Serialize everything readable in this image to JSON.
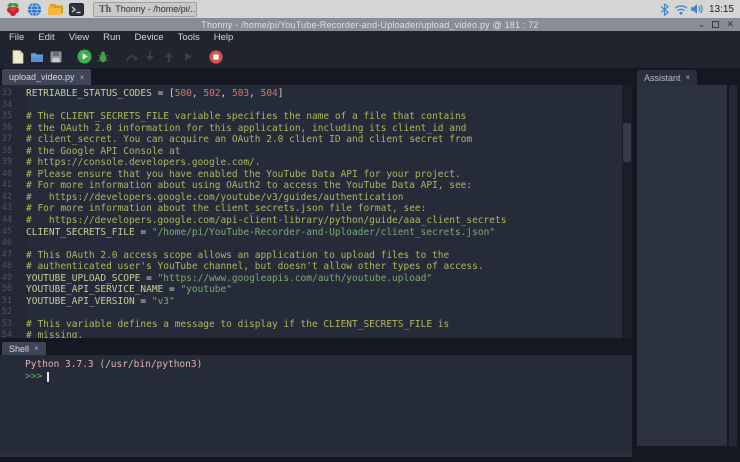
{
  "taskbar": {
    "launcher_icons": [
      "raspberry-menu",
      "web-browser",
      "file-manager",
      "terminal"
    ],
    "window_button": "Thonny - /home/pi/...",
    "status_icons": [
      "bluetooth",
      "wifi",
      "volume"
    ],
    "clock": "13:15"
  },
  "titlebar": {
    "title": "Thonny  -  /home/pi/YouTube-Recorder-and-Uploader/upload_video.py  @  181 : 72",
    "controls": {
      "minimize": "⌄",
      "maximize": "",
      "close": "✕"
    }
  },
  "menubar": {
    "items": [
      "File",
      "Edit",
      "View",
      "Run",
      "Device",
      "Tools",
      "Help"
    ]
  },
  "toolbar": {
    "buttons": [
      "new-file",
      "open-file",
      "save-file",
      "run-script",
      "debug-script",
      "step-over",
      "step-into",
      "step-out",
      "resume",
      "stop"
    ]
  },
  "editor": {
    "tab": {
      "label": "upload_video.py",
      "close": "×"
    },
    "first_line_number": 33,
    "lines": [
      [
        [
          "v",
          "RETRIABLE_STATUS_CODES"
        ],
        [
          "o",
          " = ["
        ],
        [
          "n",
          "500"
        ],
        [
          "o",
          ", "
        ],
        [
          "n",
          "502"
        ],
        [
          "o",
          ", "
        ],
        [
          "n",
          "503"
        ],
        [
          "o",
          ", "
        ],
        [
          "n",
          "504"
        ],
        [
          "o",
          "]"
        ]
      ],
      [],
      [
        [
          "c",
          "# The CLIENT_SECRETS_FILE variable specifies the name of a file that contains"
        ]
      ],
      [
        [
          "c",
          "# the OAuth 2.0 information for this application, including its client_id and"
        ]
      ],
      [
        [
          "c",
          "# client_secret. You can acquire an OAuth 2.0 client ID and client secret from"
        ]
      ],
      [
        [
          "c",
          "# the Google API Console at"
        ]
      ],
      [
        [
          "c",
          "# https://console.developers.google.com/."
        ]
      ],
      [
        [
          "c",
          "# Please ensure that you have enabled the YouTube Data API for your project."
        ]
      ],
      [
        [
          "c",
          "# For more information about using OAuth2 to access the YouTube Data API, see:"
        ]
      ],
      [
        [
          "c",
          "#   https://developers.google.com/youtube/v3/guides/authentication"
        ]
      ],
      [
        [
          "c",
          "# For more information about the client_secrets.json file format, see:"
        ]
      ],
      [
        [
          "c",
          "#   https://developers.google.com/api-client-library/python/guide/aaa_client_secrets"
        ]
      ],
      [
        [
          "v",
          "CLIENT_SECRETS_FILE"
        ],
        [
          "o",
          " = "
        ],
        [
          "s",
          "\"/home/pi/YouTube-Recorder-and-Uploader/client_secrets.json\""
        ]
      ],
      [],
      [
        [
          "c",
          "# This OAuth 2.0 access scope allows an application to upload files to the"
        ]
      ],
      [
        [
          "c",
          "# authenticated user's YouTube channel, but doesn't allow other types of access."
        ]
      ],
      [
        [
          "v",
          "YOUTUBE_UPLOAD_SCOPE"
        ],
        [
          "o",
          " = "
        ],
        [
          "s",
          "\"https://www.googleapis.com/auth/youtube.upload\""
        ]
      ],
      [
        [
          "v",
          "YOUTUBE_API_SERVICE_NAME"
        ],
        [
          "o",
          " = "
        ],
        [
          "s",
          "\"youtube\""
        ]
      ],
      [
        [
          "v",
          "YOUTUBE_API_VERSION"
        ],
        [
          "o",
          " = "
        ],
        [
          "s",
          "\"v3\""
        ]
      ],
      [],
      [
        [
          "c",
          "# This variable defines a message to display if the CLIENT_SECRETS_FILE is"
        ]
      ],
      [
        [
          "c",
          "# missing."
        ]
      ]
    ]
  },
  "assistant": {
    "tab": {
      "label": "Assistant",
      "close": "×"
    }
  },
  "shell": {
    "tab": {
      "label": "Shell",
      "close": "×"
    },
    "welcome": "Python 3.7.3 (/usr/bin/python3)",
    "prompt": ">>>"
  },
  "colors": {
    "taskbar_bg": "#d5d5d3",
    "titlebar_bg": "#868d95",
    "menubar_bg": "#20242f",
    "editor_bg": "#262b3a",
    "panel_bg": "#2d3242",
    "identifier": "#c9cf96",
    "comment": "#b0b75a",
    "string": "#7cab71",
    "number": "#d4776f",
    "prompt_green": "#4cbb58",
    "welcome_pink": "#e3b0b0",
    "status_blue": "#3f83d6",
    "run_green": "#3fae4c",
    "stop_red": "#d6574a"
  }
}
